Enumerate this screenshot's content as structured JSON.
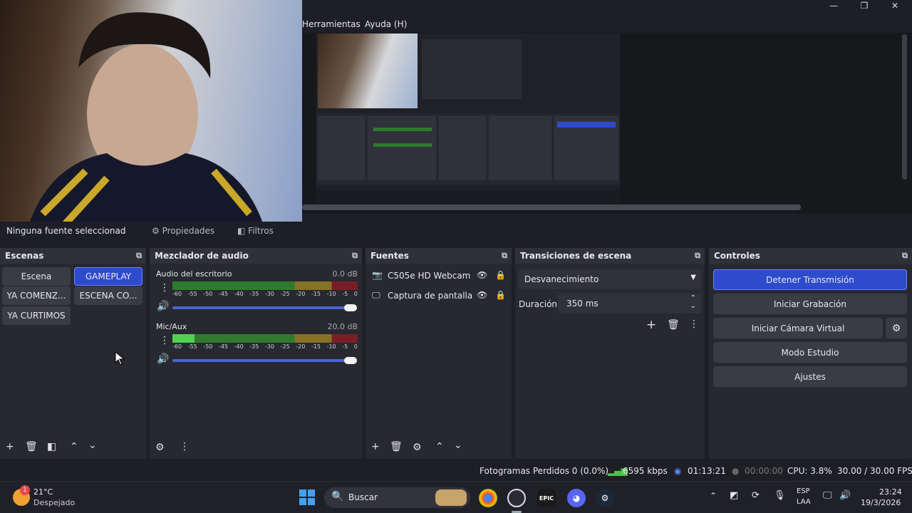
{
  "menu": {
    "tools": "Herramientas",
    "help": "Ayuda (H)"
  },
  "window_controls": {
    "minimize": "—",
    "maximize": "❐",
    "close": "✕"
  },
  "source_toolbar": {
    "no_source": "Ninguna fuente seleccionad",
    "properties": "Propiedades",
    "filters": "Filtros"
  },
  "scenes": {
    "title": "Escenas",
    "items": [
      "Escena",
      "GAMEPLAY",
      "YA COMENZ...",
      "ESCENA CO...",
      "YA CURTIMOS"
    ],
    "active": "GAMEPLAY"
  },
  "mixer": {
    "title": "Mezclador de audio",
    "tick_labels": [
      "-60",
      "-55",
      "-50",
      "-45",
      "-40",
      "-35",
      "-30",
      "-25",
      "-20",
      "-15",
      "-10",
      "-5",
      "0"
    ],
    "channels": [
      {
        "name": "Audio del escritorio",
        "db": "0.0 dB",
        "level": 0.0
      },
      {
        "name": "Mic/Aux",
        "db": "20.0 dB",
        "level": 0.12
      }
    ]
  },
  "sources": {
    "title": "Fuentes",
    "items": [
      {
        "name": "C505e HD Webcam",
        "icon": "camera-icon"
      },
      {
        "name": "Captura de pantalla",
        "icon": "monitor-icon"
      }
    ]
  },
  "transitions": {
    "title": "Transiciones de escena",
    "selected": "Desvanecimiento",
    "duration_label": "Duración",
    "duration_value": "350 ms"
  },
  "controls": {
    "title": "Controles",
    "stop_stream": "Detener Transmisión",
    "start_recording": "Iniciar Grabación",
    "virtual_camera": "Iniciar Cámara Virtual",
    "studio_mode": "Modo Estudio",
    "settings": "Ajustes"
  },
  "status": {
    "dropped_frames": "Fotogramas Perdidos 0 (0.0%)",
    "bitrate": "6595 kbps",
    "stream_time": "01:13:21",
    "rec_time": "00:00:00",
    "cpu": "CPU: 3.8%",
    "fps": "30.00 / 30.00 FPS"
  },
  "taskbar": {
    "weather_temp": "21°C",
    "weather_desc": "Despejado",
    "weather_badge": "1",
    "search": "Buscar",
    "lang_top": "ESP",
    "lang_bottom": "LAA",
    "time": "23:24",
    "date": "19/3/2026"
  },
  "colors": {
    "accent": "#2d4bcc",
    "dock_bg": "#272830",
    "green_meter": "#2f7a2f",
    "yellow_meter": "#857224",
    "red_meter": "#7a1e25"
  }
}
